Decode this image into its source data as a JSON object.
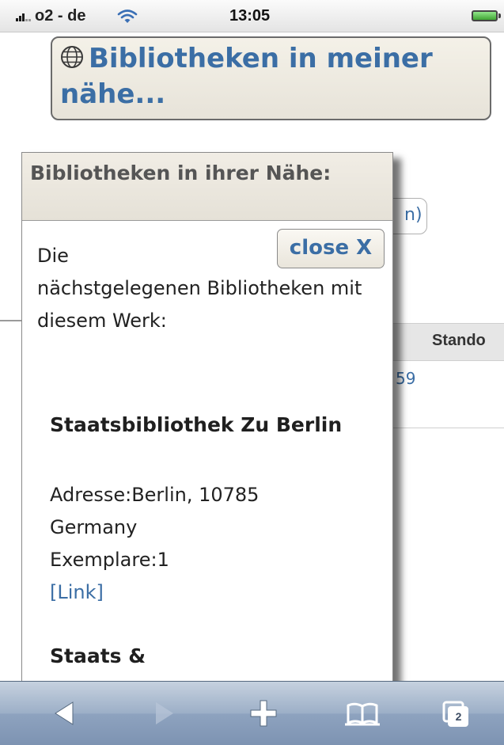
{
  "status_bar": {
    "carrier": "o2 - de",
    "time": "13:05"
  },
  "page": {
    "nearby_button_label": "Bibliotheken in meiner nähe...",
    "bg_pill_text": "n)",
    "bg_table_header": "Stando",
    "bg_table_value": "59"
  },
  "popup": {
    "title": "Bibliotheken in ihrer Nähe:",
    "close_label": "close X",
    "intro_line1": "Die",
    "intro_rest": "nächstgelegenen Bibliotheken mit diesem Werk:",
    "libraries": [
      {
        "name": "Staatsbibliothek Zu Berlin",
        "address": "Adresse:Berlin, 10785",
        "country": "Germany",
        "copies": "Exemplare:1",
        "link_text": "[Link]"
      },
      {
        "name": "Staats &"
      }
    ]
  },
  "toolbar": {
    "items": [
      "back-icon",
      "forward-icon",
      "add-icon",
      "bookmarks-icon",
      "tabs-icon"
    ],
    "tab_count": "2"
  }
}
